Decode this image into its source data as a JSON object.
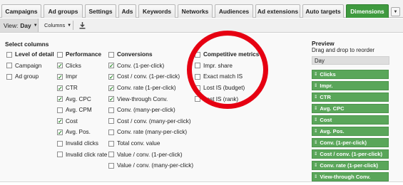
{
  "tabs": [
    {
      "label": "Campaigns",
      "active": false
    },
    {
      "label": "Ad groups",
      "active": false
    },
    {
      "label": "Settings",
      "active": false
    },
    {
      "label": "Ads",
      "active": false
    },
    {
      "label": "Keywords",
      "active": false
    },
    {
      "label": "Networks",
      "active": false
    },
    {
      "label": "Audiences",
      "active": false
    },
    {
      "label": "Ad extensions",
      "active": false
    },
    {
      "label": "Auto targets",
      "active": false
    },
    {
      "label": "Dimensions",
      "active": true
    }
  ],
  "tab_menu_icon": "chevron-down-icon",
  "toolbar": {
    "view_label": "View:",
    "view_value": "Day",
    "columns_label": "Columns",
    "download_icon": "download-icon"
  },
  "select_columns_title": "Select columns",
  "columns": {
    "level": [
      {
        "label": "Level of detail",
        "checked": false,
        "head": true
      },
      {
        "label": "Campaign",
        "checked": false
      },
      {
        "label": "Ad group",
        "checked": false
      }
    ],
    "performance": [
      {
        "label": "Performance",
        "checked": false,
        "head": true
      },
      {
        "label": "Clicks",
        "checked": true
      },
      {
        "label": "Impr",
        "checked": true
      },
      {
        "label": "CTR",
        "checked": true
      },
      {
        "label": "Avg. CPC",
        "checked": true
      },
      {
        "label": "Avg. CPM",
        "checked": false
      },
      {
        "label": "Cost",
        "checked": true
      },
      {
        "label": "Avg. Pos.",
        "checked": true
      },
      {
        "label": "Invalid clicks",
        "checked": false
      },
      {
        "label": "Invalid click rate",
        "checked": false
      }
    ],
    "conversions": [
      {
        "label": "Conversions",
        "checked": false,
        "head": true
      },
      {
        "label": "Conv. (1-per-click)",
        "checked": true
      },
      {
        "label": "Cost / conv. (1-per-click)",
        "checked": true
      },
      {
        "label": "Conv. rate (1-per-click)",
        "checked": true
      },
      {
        "label": "View-through Conv.",
        "checked": true
      },
      {
        "label": "Conv. (many-per-click)",
        "checked": false
      },
      {
        "label": "Cost / conv. (many-per-click)",
        "checked": false
      },
      {
        "label": "Conv. rate (many-per-click)",
        "checked": false
      },
      {
        "label": "Total conv. value",
        "checked": false
      },
      {
        "label": "Value / conv. (1-per-click)",
        "checked": false
      },
      {
        "label": "Value / conv. (many-per-click)",
        "checked": false
      }
    ],
    "competitive": [
      {
        "label": "Competitive metrics",
        "checked": false,
        "head": true
      },
      {
        "label": "Impr. share",
        "checked": false
      },
      {
        "label": "Exact match IS",
        "checked": false
      },
      {
        "label": "Lost IS (budget)",
        "checked": false
      },
      {
        "label": "Lost IS (rank)",
        "checked": false
      }
    ]
  },
  "preview": {
    "title": "Preview",
    "subtitle": "Drag and drop to reorder",
    "fixed_item": "Day",
    "items": [
      "Clicks",
      "Impr.",
      "CTR",
      "Avg. CPC",
      "Cost",
      "Avg. Pos.",
      "Conv. (1-per-click)",
      "Cost / conv. (1-per-click)",
      "Conv. rate (1-per-click)",
      "View-through Conv."
    ]
  },
  "colors": {
    "active_tab": "#3f9a3f",
    "preview_item": "#5aa65a",
    "highlight_circle": "#e60012"
  }
}
